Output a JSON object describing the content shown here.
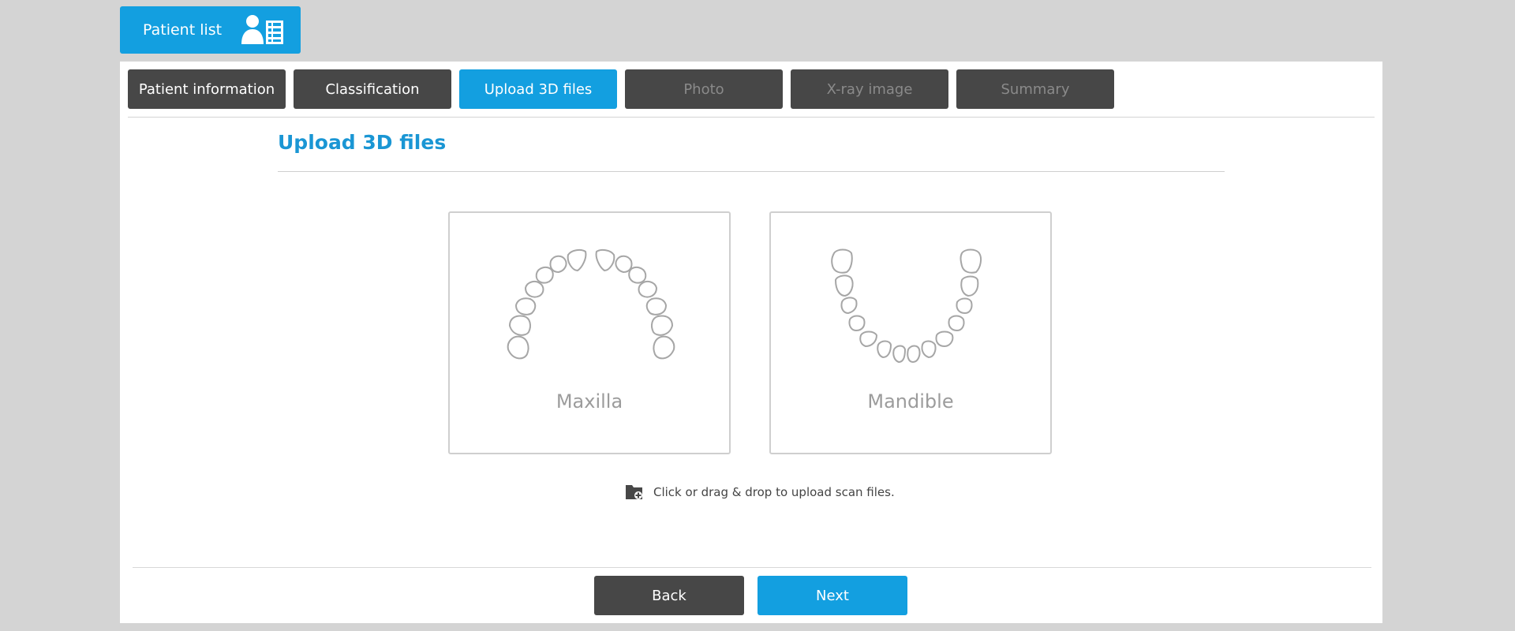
{
  "header": {
    "patient_list_label": "Patient list",
    "patient_list_icon": "patient-list-icon"
  },
  "tabs": [
    {
      "label": "Patient information",
      "state": "normal"
    },
    {
      "label": "Classification",
      "state": "normal"
    },
    {
      "label": "Upload 3D files",
      "state": "active"
    },
    {
      "label": "Photo",
      "state": "disabled"
    },
    {
      "label": "X-ray image",
      "state": "disabled"
    },
    {
      "label": "Summary",
      "state": "disabled"
    }
  ],
  "section": {
    "title": "Upload 3D files"
  },
  "cards": {
    "maxilla": {
      "label": "Maxilla",
      "icon": "maxilla-arch-icon"
    },
    "mandible": {
      "label": "Mandible",
      "icon": "mandible-arch-icon"
    }
  },
  "upload": {
    "hint": "Click or drag & drop to upload scan files.",
    "icon": "folder-add-icon"
  },
  "footer": {
    "back_label": "Back",
    "next_label": "Next"
  },
  "colors": {
    "accent": "#139fe0",
    "dark_button": "#474747",
    "title": "#1a96d4",
    "background": "#d4d4d4"
  }
}
